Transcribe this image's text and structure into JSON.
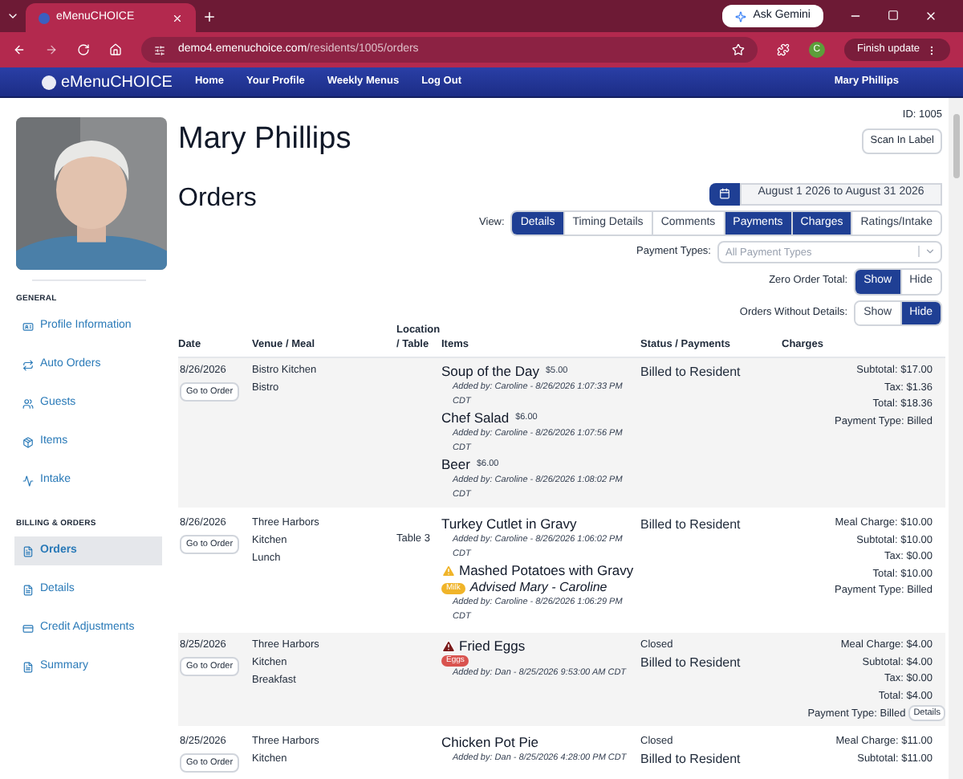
{
  "browser": {
    "tab_title": "eMenuCHOICE",
    "url_host": "demo4.emenuchoice.com",
    "url_path": "/residents/1005/orders",
    "gemini": "Ask Gemini",
    "profile_initial": "C",
    "update": "Finish update"
  },
  "nav": {
    "logo": "eMenuCHOICE",
    "links": [
      "Home",
      "Your Profile",
      "Weekly Menus",
      "Log Out"
    ],
    "user": "Mary Phillips"
  },
  "resident": {
    "name": "Mary Phillips",
    "id": "ID: 1005",
    "scan_button": "Scan In Label"
  },
  "sidebar": {
    "sections": [
      {
        "title": "GENERAL",
        "items": [
          {
            "label": "Profile Information",
            "selected": false
          },
          {
            "label": "Auto Orders",
            "selected": false
          },
          {
            "label": "Guests",
            "selected": false
          },
          {
            "label": "Items",
            "selected": false
          },
          {
            "label": "Intake",
            "selected": false
          }
        ]
      },
      {
        "title": "BILLING & ORDERS",
        "items": [
          {
            "label": "Orders",
            "selected": true
          },
          {
            "label": "Details",
            "selected": false
          },
          {
            "label": "Credit Adjustments",
            "selected": false
          },
          {
            "label": "Summary",
            "selected": false
          }
        ]
      }
    ]
  },
  "page_title": "Orders",
  "date_range": "August 1 2026 to August 31 2026",
  "view": {
    "label": "View:",
    "options": [
      {
        "label": "Details",
        "selected": true
      },
      {
        "label": "Timing Details",
        "selected": false
      },
      {
        "label": "Comments",
        "selected": false
      },
      {
        "label": "Payments",
        "selected": true
      },
      {
        "label": "Charges",
        "selected": true
      },
      {
        "label": "Ratings/Intake",
        "selected": false
      }
    ]
  },
  "payment_types": {
    "label": "Payment Types:",
    "placeholder": "All Payment Types"
  },
  "toggles": [
    {
      "label": "Zero Order Total:",
      "options": [
        {
          "label": "Show",
          "selected": true
        },
        {
          "label": "Hide",
          "selected": false
        }
      ]
    },
    {
      "label": "Orders Without Details:",
      "options": [
        {
          "label": "Show",
          "selected": false
        },
        {
          "label": "Hide",
          "selected": true
        }
      ]
    }
  ],
  "table": {
    "columns": [
      "Date",
      "Venue / Meal",
      "Location / Table",
      "Items",
      "Status / Payments",
      "Charges"
    ],
    "rows": [
      {
        "date": "8/26/2026",
        "button": "Go to Order",
        "venue": [
          "Bistro Kitchen",
          "Bistro"
        ],
        "location": "",
        "items": [
          {
            "name": "Soup of the Day",
            "price": "$5.00",
            "added": "Added by: Caroline - 8/26/2026 1:07:33 PM CDT"
          },
          {
            "name": "Chef Salad",
            "price": "$6.00",
            "added": "Added by: Caroline - 8/26/2026 1:07:56 PM CDT"
          },
          {
            "name": "Beer",
            "price": "$6.00",
            "added": "Added by: Caroline - 8/26/2026 1:08:02 PM CDT"
          }
        ],
        "status": [],
        "payment": "Billed to Resident",
        "charges": [
          {
            "label": "Subtotal:",
            "value": "$17.00"
          },
          {
            "label": "Tax:",
            "value": "$1.36"
          },
          {
            "label": "Total:",
            "value": "$18.36"
          },
          {
            "label": "Payment Type:",
            "value": "Billed"
          }
        ]
      },
      {
        "date": "8/26/2026",
        "button": "Go to Order",
        "venue": [
          "Three Harbors",
          "Kitchen",
          "Lunch"
        ],
        "location": "Table 3",
        "items": [
          {
            "name": "Turkey Cutlet in Gravy",
            "added": "Added by: Caroline - 8/26/2026 1:06:02 PM CDT"
          },
          {
            "name": "Mashed Potatoes with Gravy",
            "kind": "caution",
            "tag": {
              "text": "Milk",
              "color": "#f0b429"
            },
            "note": "Advised Mary - Caroline",
            "added": "Added by: Caroline - 8/26/2026 1:06:29 PM CDT"
          }
        ],
        "status": [],
        "payment": "Billed to Resident",
        "charges": [
          {
            "label": "Meal Charge:",
            "value": "$10.00"
          },
          {
            "label": "Subtotal:",
            "value": "$10.00"
          },
          {
            "label": "Tax:",
            "value": "$0.00"
          },
          {
            "label": "Total:",
            "value": "$10.00"
          },
          {
            "label": "Payment Type:",
            "value": "Billed"
          }
        ]
      },
      {
        "date": "8/25/2026",
        "button": "Go to Order",
        "venue": [
          "Three Harbors",
          "Kitchen",
          "Breakfast"
        ],
        "location": "",
        "items": [
          {
            "name": "Fried Eggs",
            "kind": "danger",
            "tag": {
              "text": "Eggs",
              "color": "#d9534f"
            },
            "added": "Added by: Dan - 8/25/2026 9:53:00 AM CDT"
          }
        ],
        "status": [
          "Closed"
        ],
        "payment": "Billed to Resident",
        "charges": [
          {
            "label": "Meal Charge:",
            "value": "$4.00"
          },
          {
            "label": "Subtotal:",
            "value": "$4.00"
          },
          {
            "label": "Tax:",
            "value": "$0.00"
          },
          {
            "label": "Total:",
            "value": "$4.00"
          },
          {
            "label": "Payment Type:",
            "value": "Billed"
          }
        ],
        "details_button": "Details"
      },
      {
        "date": "8/25/2026",
        "button": "Go to Order",
        "venue": [
          "Three Harbors",
          "Kitchen"
        ],
        "location": "",
        "items": [
          {
            "name": "Chicken Pot Pie",
            "added": "Added by: Dan - 8/25/2026 4:28:00 PM CDT"
          }
        ],
        "status": [
          "Closed"
        ],
        "payment": "Billed to Resident",
        "charges": [
          {
            "label": "Meal Charge:",
            "value": "$11.00"
          },
          {
            "label": "Subtotal:",
            "value": "$11.00"
          }
        ]
      }
    ]
  }
}
